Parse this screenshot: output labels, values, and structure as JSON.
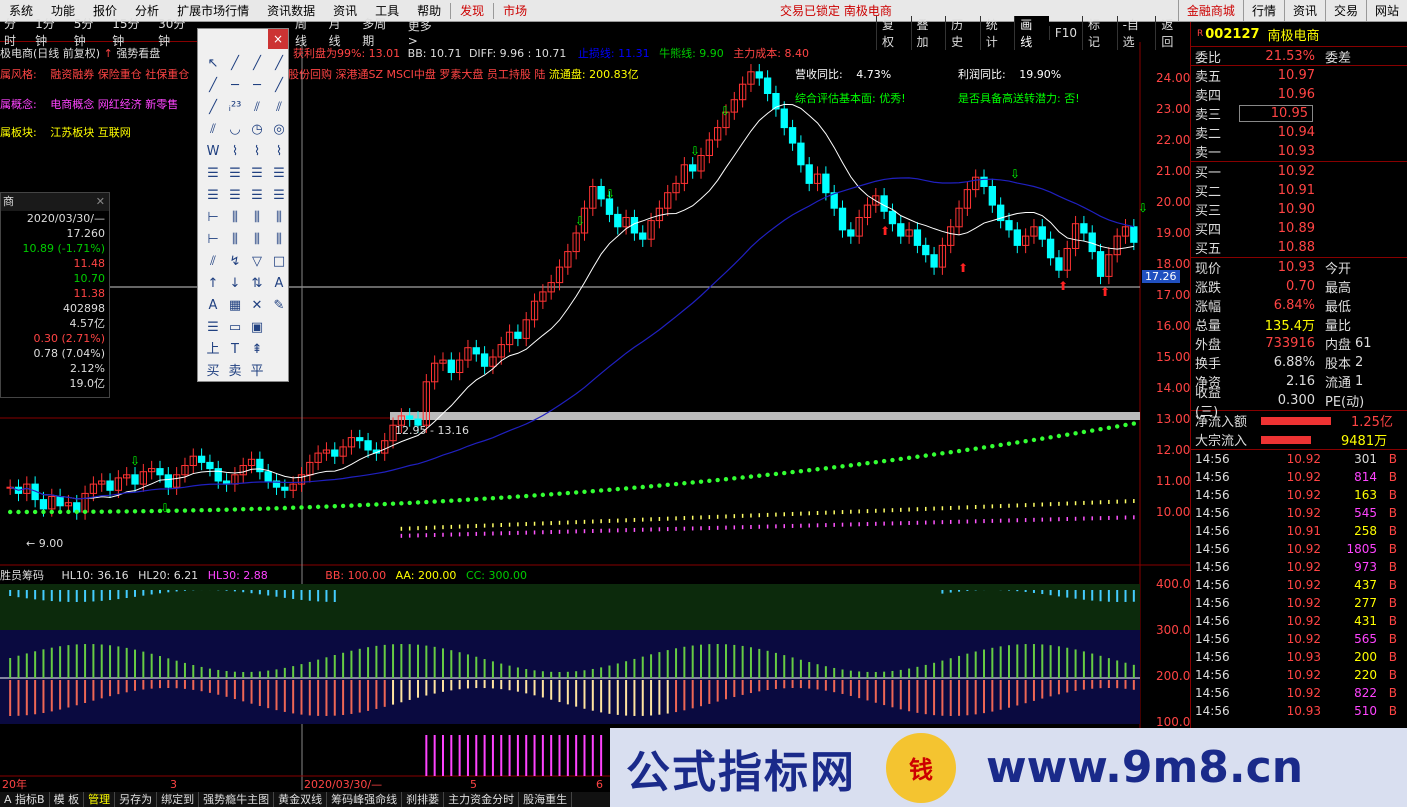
{
  "menu": [
    "系统",
    "功能",
    "报价",
    "分析",
    "扩展市场行情",
    "资讯数据",
    "资讯",
    "工具",
    "帮助"
  ],
  "menu_red": [
    "发现",
    "市场"
  ],
  "status": "交易已锁定  南极电商",
  "right_buttons": [
    "金融商城",
    "行情",
    "资讯",
    "交易",
    "网站"
  ],
  "timeframes": [
    "分时",
    "1分钟",
    "5分钟",
    "15分钟",
    "30分钟"
  ],
  "timeframes2": [
    "周线",
    "月线",
    "多周期",
    "更多 >"
  ],
  "toolbar": [
    "复权",
    "叠加",
    "历史",
    "统计",
    "画线",
    "F10",
    "标记",
    "-自选",
    "返回"
  ],
  "chart_header": {
    "stock_title": "极电商(日线 前复权)",
    "strong_view": "强势看盘",
    "profit_ratio": "获利盘为99%: 13.01",
    "bb": "BB: 10.71",
    "diff": "DIFF: 9.96",
    "val": ": 10.71",
    "up_line": "止损线: 11.31",
    "bull_line": "牛熊线: 9.90",
    "main_cost": "主力成本: 8.40",
    "risk_label": "属风格:",
    "risk_items": "融资融券 保险重仓 社保重仓",
    "risk_items2": "股份回购 深港通SZ MSCI中盘 罗素大盘 员工持股 陆",
    "float_label": "流通盘: 200.83亿",
    "concept_label": "属概念:",
    "concept_items": "电商概念 网红经济 新零售",
    "sector_label": "属板块:",
    "sector_items": "江苏板块   互联网",
    "revenue_yoy_label": "营收同比:",
    "revenue_yoy": "4.73%",
    "profit_yoy_label": "利润同比:",
    "profit_yoy": "19.90%",
    "fundamental": "综合评估基本面: 优秀!",
    "high_transfer": "是否具备高送转潜力: 否!",
    "price_range": "12.95 - 13.16",
    "low_mark": "← 9.00",
    "cursor_price": "17.26"
  },
  "left_panel": {
    "title": "商",
    "rows": [
      {
        "v": "2020/03/30/—",
        "c": "#ddd"
      },
      {
        "v": "17.260",
        "c": "#ddd"
      },
      {
        "v": "10.89 (-1.71%)",
        "c": "#0c0"
      },
      {
        "v": "11.48",
        "c": "#f44"
      },
      {
        "v": "10.70",
        "c": "#0c0"
      },
      {
        "v": "11.38",
        "c": "#f44"
      },
      {
        "v": "402898",
        "c": "#ddd"
      },
      {
        "v": "4.57亿",
        "c": "#ddd"
      },
      {
        "v": "0.30 (2.71%)",
        "c": "#f44"
      },
      {
        "v": "0.78 (7.04%)",
        "c": "#ddd"
      },
      {
        "v": "2.12%",
        "c": "#ddd"
      },
      {
        "v": "19.0亿",
        "c": "#ddd"
      }
    ]
  },
  "draw_tools": [
    "↖",
    "╱",
    "╱",
    "╱",
    "╱",
    "─",
    "─",
    "╱",
    "╱",
    "ᵢ²³",
    "⫽",
    "⫽",
    "⫽",
    "◡",
    "◷",
    "◎",
    "W",
    "⌇",
    "⌇",
    "⌇",
    "☰",
    "☰",
    "☰",
    "☰",
    "☰",
    "☰",
    "☰",
    "☰",
    "⊢",
    "⫼",
    "⫼",
    "⫼",
    "⊢",
    "⫼",
    "⫼",
    "⫼",
    "⫽",
    "↯",
    "▽",
    "□",
    "↑",
    "↓",
    "⇅",
    "A",
    "A",
    "▦",
    "✕",
    "✎",
    "☰",
    "▭",
    "▣",
    "",
    "上",
    "T",
    "⇞",
    "",
    "买",
    "卖",
    "平",
    ""
  ],
  "indicator": {
    "title": "胜员筹码",
    "hl10": "HL10: 36.16",
    "hl20": "HL20: 6.21",
    "hl30": "HL30: 2.88",
    "bb": "BB: 100.00",
    "aa": "AA: 200.00",
    "cc": "CC: 300.00"
  },
  "date_axis": [
    "20年",
    "3",
    "2020/03/30/—",
    "5",
    "6"
  ],
  "bottom_tabs": [
    "A 指标B",
    "模 板",
    "管理",
    "另存为",
    "绑定到",
    "强势瘾牛主图",
    "黄金双线",
    "筹码峰强命线",
    "刹排蒌",
    "主力资金分时",
    "股海重生"
  ],
  "price_axis": [
    "24.00",
    "23.00",
    "22.00",
    "21.00",
    "20.00",
    "19.00",
    "18.00",
    "17.00",
    "16.00",
    "15.00",
    "14.00",
    "13.00",
    "12.00",
    "11.00",
    "10.00"
  ],
  "ind_axis": [
    "400.0",
    "300.0",
    "200.0",
    "100.0"
  ],
  "quote": {
    "code": "002127",
    "name": "南极电商",
    "weibi_label": "委比",
    "weibi": "21.53%",
    "weicha_label": "委差",
    "asks": [
      {
        "l": "卖五",
        "v": "10.97"
      },
      {
        "l": "卖四",
        "v": "10.96"
      },
      {
        "l": "卖三",
        "v": "10.95"
      },
      {
        "l": "卖二",
        "v": "10.94"
      },
      {
        "l": "卖一",
        "v": "10.93"
      }
    ],
    "bids": [
      {
        "l": "买一",
        "v": "10.92"
      },
      {
        "l": "买二",
        "v": "10.91"
      },
      {
        "l": "买三",
        "v": "10.90"
      },
      {
        "l": "买四",
        "v": "10.89"
      },
      {
        "l": "买五",
        "v": "10.88"
      }
    ],
    "stats": [
      {
        "l": "现价",
        "v": "10.93",
        "c": "#f44",
        "l2": "今开"
      },
      {
        "l": "涨跌",
        "v": "0.70",
        "c": "#f44",
        "l2": "最高"
      },
      {
        "l": "涨幅",
        "v": "6.84%",
        "c": "#f44",
        "l2": "最低"
      },
      {
        "l": "总量",
        "v": "135.4万",
        "c": "#ff0",
        "l2": "量比"
      },
      {
        "l": "外盘",
        "v": "733916",
        "c": "#f44",
        "l2": "内盘",
        "v2": "61"
      },
      {
        "l": "换手",
        "v": "6.88%",
        "c": "#ddd",
        "l2": "股本",
        "v2": "2"
      },
      {
        "l": "净资",
        "v": "2.16",
        "c": "#ddd",
        "l2": "流通",
        "v2": "1"
      },
      {
        "l": "收益(三)",
        "v": "0.300",
        "c": "#ddd",
        "l2": "PE(动)"
      }
    ],
    "netflow_label": "净流入额",
    "netflow": "1.25亿",
    "block_label": "大宗流入",
    "block": "9481万",
    "ticks": [
      {
        "t": "14:56",
        "p": "10.92",
        "q": "301",
        "c": "#ddd"
      },
      {
        "t": "14:56",
        "p": "10.92",
        "q": "814",
        "c": "#f4f"
      },
      {
        "t": "14:56",
        "p": "10.92",
        "q": "163",
        "c": "#ff0"
      },
      {
        "t": "14:56",
        "p": "10.92",
        "q": "545",
        "c": "#f4f"
      },
      {
        "t": "14:56",
        "p": "10.91",
        "q": "258",
        "c": "#ff0"
      },
      {
        "t": "14:56",
        "p": "10.92",
        "q": "1805",
        "c": "#f4f"
      },
      {
        "t": "14:56",
        "p": "10.92",
        "q": "973",
        "c": "#f4f"
      },
      {
        "t": "14:56",
        "p": "10.92",
        "q": "437",
        "c": "#ff0"
      },
      {
        "t": "14:56",
        "p": "10.92",
        "q": "277",
        "c": "#ff0"
      },
      {
        "t": "14:56",
        "p": "10.92",
        "q": "431",
        "c": "#ff0"
      },
      {
        "t": "14:56",
        "p": "10.92",
        "q": "565",
        "c": "#f4f"
      },
      {
        "t": "14:56",
        "p": "10.93",
        "q": "200",
        "c": "#ff0"
      },
      {
        "t": "14:56",
        "p": "10.92",
        "q": "220",
        "c": "#ff0"
      },
      {
        "t": "14:56",
        "p": "10.92",
        "q": "822",
        "c": "#f4f"
      },
      {
        "t": "14:56",
        "p": "10.93",
        "q": "510",
        "c": "#f4f"
      }
    ]
  },
  "watermark": {
    "text1": "公式指标网",
    "logo": "钱",
    "text2": "www.9m8.cn"
  },
  "colors": {
    "up": "#ff3333",
    "down": "#00ffff",
    "ma": "#ffffff",
    "ma2": "#2020c0",
    "dots": "#33ff33"
  }
}
